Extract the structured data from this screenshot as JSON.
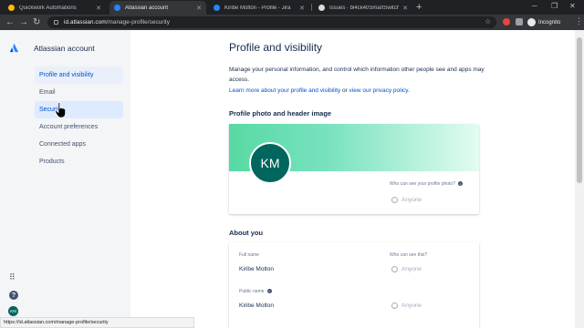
{
  "browser": {
    "tabs": [
      {
        "title": "Quickwork Automations",
        "favicon_color": "#fbbc04"
      },
      {
        "title": "Atlassian account",
        "favicon_color": "#2684ff"
      },
      {
        "title": "Kiribe Molton - Profile - Jira",
        "favicon_color": "#2684ff"
      },
      {
        "title": "Issues · bl4ck4t/SmartSwitches",
        "favicon_color": "#202124"
      }
    ],
    "url_host": "id.atlassian.com",
    "url_path": "/manage-profile/security",
    "incognito_label": "Incognito",
    "status_url": "https://id.atlassian.com/manage-profile/security"
  },
  "sidebar": {
    "brand": "Atlassian account",
    "items": [
      {
        "label": "Profile and visibility"
      },
      {
        "label": "Email"
      },
      {
        "label": "Security"
      },
      {
        "label": "Account preferences"
      },
      {
        "label": "Connected apps"
      },
      {
        "label": "Products"
      }
    ],
    "user_initials": "KM"
  },
  "main": {
    "title": "Profile and visibility",
    "description": "Manage your personal information, and control which information other people see and apps may access.",
    "learn_more_link": "Learn more about your profile and visibility",
    "or_text": "or",
    "privacy_link": "view our privacy policy",
    "photo_section": {
      "title": "Profile photo and header image",
      "initials": "KM",
      "who_can_see": "Who can see your profile photo?",
      "visibility": "Anyone"
    },
    "about_section": {
      "title": "About you",
      "who_can_see": "Who can see this?",
      "full_name_label": "Full name",
      "full_name_value": "Kiribe Molton",
      "full_name_visibility": "Anyone",
      "public_name_label": "Public name",
      "public_name_value": "Kiribe Molton",
      "public_name_visibility": "Anyone"
    }
  }
}
